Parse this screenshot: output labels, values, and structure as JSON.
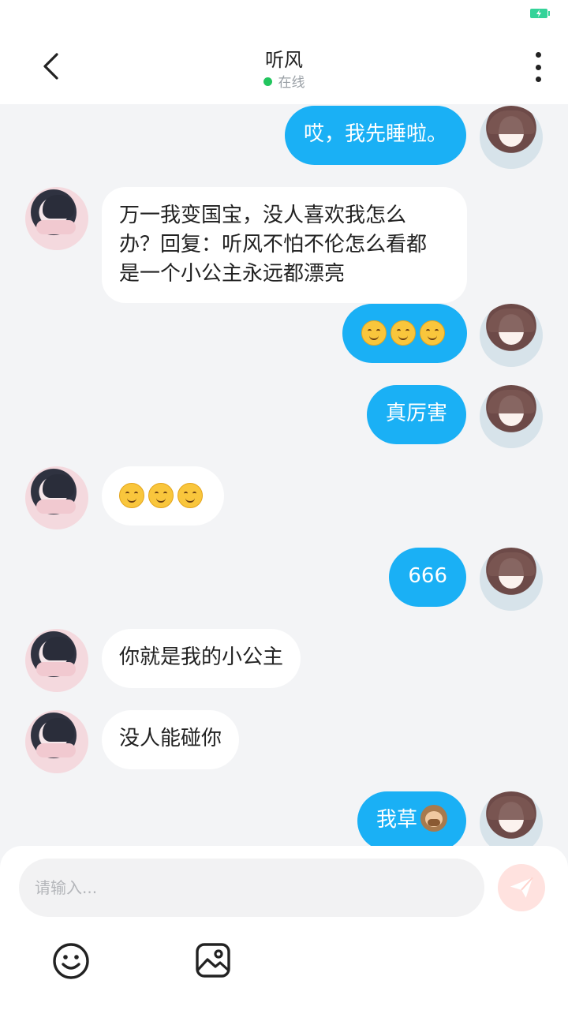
{
  "header": {
    "title": "听风",
    "status": "在线",
    "status_color": "#22c55e"
  },
  "icons": {
    "back": "chevron-left-icon",
    "more": "more-vertical-icon",
    "battery": "battery-charging-icon",
    "send": "send-icon",
    "emoji": "emoji-icon",
    "image": "image-icon"
  },
  "colors": {
    "sent_bubble": "#1ab0f5",
    "received_bubble": "#ffffff",
    "background": "#f3f4f6"
  },
  "messages": [
    {
      "side": "sent",
      "text": "哎，我先睡啦。"
    },
    {
      "side": "received",
      "lines": [
        "万一我变国宝，没人喜欢我怎么",
        "办？回复：听风不怕不伦怎么看都",
        "是一个小公主永远都漂亮"
      ]
    },
    {
      "side": "sent",
      "emoji": "smiling-face-emoji x3"
    },
    {
      "side": "sent",
      "text": "真厉害"
    },
    {
      "side": "received",
      "emoji": "smiling-face-emoji x3"
    },
    {
      "side": "sent",
      "text": "666"
    },
    {
      "side": "received",
      "text": "你就是我的小公主"
    },
    {
      "side": "received",
      "text": "没人能碰你"
    },
    {
      "side": "sent",
      "text": "我草",
      "emoji": "speak-no-evil-monkey-emoji"
    }
  ],
  "composer": {
    "placeholder": "请输入..."
  }
}
